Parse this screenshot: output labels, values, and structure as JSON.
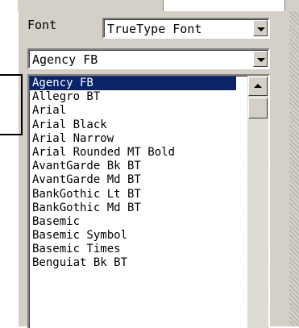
{
  "font_section": {
    "label": "Font",
    "font_type": {
      "value": "TrueType Font"
    },
    "font_name": {
      "value": "Agency FB"
    },
    "font_list": {
      "selected_index": 0,
      "items": [
        "Agency FB",
        "Allegro BT",
        "Arial",
        "Arial Black",
        "Arial Narrow",
        "Arial Rounded MT Bold",
        "AvantGarde Bk BT",
        "AvantGarde Md BT",
        "BankGothic Lt BT",
        "BankGothic Md BT",
        "Basemic",
        "Basemic Symbol",
        "Basemic Times",
        "Benguiat Bk BT"
      ]
    }
  },
  "icons": {
    "dropdown": "chevron-down-icon",
    "scroll_up": "scroll-up-arrow-icon"
  },
  "colors": {
    "selection_bg": "#0a246a",
    "selection_fg": "#ffffff",
    "panel_bg": "#d4d0c8"
  }
}
